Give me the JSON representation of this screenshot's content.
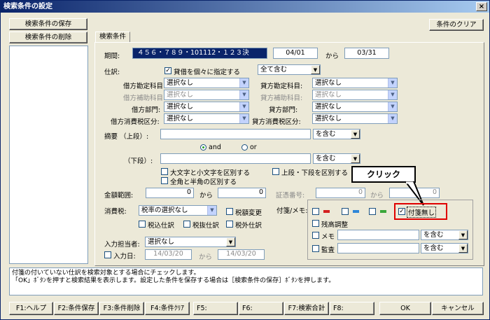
{
  "window": {
    "title": "検索条件の設定",
    "close": "×"
  },
  "left": {
    "save": "検索条件の保存",
    "delete": "検索条件の削除"
  },
  "clear": "条件のクリア",
  "tab": "検索条件",
  "period": {
    "label": "期間:",
    "months": "４５６・７８９・101112・１２３決",
    "from": "04/01",
    "kara": "から",
    "to": "03/31"
  },
  "journal": {
    "label": "仕訳:",
    "check": "貸借を個々に指定する",
    "check_mark": "✓",
    "select": "全て含む"
  },
  "rows": [
    {
      "l1": "借方勘定科目:",
      "v1": "選択なし",
      "l2": "貸方勘定科目:",
      "v2": "選択なし"
    },
    {
      "l1": "借方補助科目:",
      "v1": "選択なし",
      "l2": "貸方補助科目:",
      "v2": "選択なし"
    },
    {
      "l1": "借方部門:",
      "v1": "選択なし",
      "l2": "貸方部門:",
      "v2": "選択なし"
    },
    {
      "l1": "借方消費税区分:",
      "v1": "選択なし",
      "l2": "貸方消費税区分:",
      "v2": "選択なし"
    }
  ],
  "memo1": {
    "label": "摘要  （上段）:",
    "mode": "を含む"
  },
  "andor": {
    "and": "and",
    "or": "or"
  },
  "memo2": {
    "label": "（下段）:",
    "mode": "を含む"
  },
  "opts": {
    "case": "大文字と小文字を区別する",
    "updown": "上段・下段を区別する",
    "width": "全角と半角の区別する"
  },
  "amount": {
    "label": "金額範囲:",
    "from": "0",
    "kara": "から",
    "to": "0"
  },
  "voucher": {
    "label": "証憑番号:",
    "from": "0",
    "kara": "から",
    "to": "0"
  },
  "callout": "クリック",
  "tax": {
    "label": "消費税:",
    "select": "税率の選択なし",
    "c1": "税額変更",
    "c2": "税込仕訳",
    "c3": "税抜仕訳",
    "c4": "税外仕訳"
  },
  "tag": {
    "label": "付箋/メモ:",
    "none": "付箋無し",
    "none_mark": "✓",
    "balance": "残高調整",
    "memo": "メモ",
    "memo_mode": "を含む",
    "audit": "監査",
    "audit_mode": "を含む",
    "colors": [
      "#d42020",
      "#2e86d8",
      "#3aa73a"
    ]
  },
  "person": {
    "label": "入力担当者:",
    "select": "選択なし"
  },
  "inputdate": {
    "label": "入力日:",
    "from": "14/03/20",
    "kara": "から",
    "to": "14/03/20"
  },
  "hint": {
    "line1": "付箋の付いていない仕訳を検索対象とする場合にチェックします。",
    "line2": "「OK」ﾎﾞﾀﾝを押すと検索結果を表示します。設定した条件を保存する場合は［検索条件の保存］ﾎﾞﾀﾝを押します。"
  },
  "fkeys": [
    "F1:ヘルプ",
    "F2:条件保存",
    "F3:条件削除",
    "F4:条件ｸﾘｱ",
    "F5:",
    "F6:",
    "F7:検索合計",
    "F8:"
  ],
  "ok": "OK",
  "cancel": "キャンセル",
  "dropdown_glyph": "▼"
}
